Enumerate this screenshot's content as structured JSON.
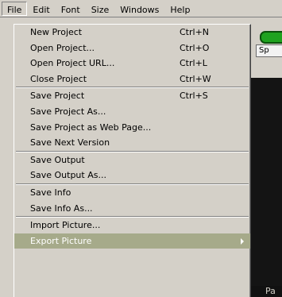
{
  "menubar": {
    "items": [
      {
        "label": "File"
      },
      {
        "label": "Edit"
      },
      {
        "label": "Font"
      },
      {
        "label": "Size"
      },
      {
        "label": "Windows"
      },
      {
        "label": "Help"
      }
    ]
  },
  "background": {
    "tab_label": "Sp",
    "bottom_text": "Pa",
    "pill_color": "#1fa21f"
  },
  "file_menu": {
    "items": [
      {
        "label": "New Project",
        "shortcut": "Ctrl+N"
      },
      {
        "label": "Open Project...",
        "shortcut": "Ctrl+O"
      },
      {
        "label": "Open Project URL...",
        "shortcut": "Ctrl+L"
      },
      {
        "label": "Close Project",
        "shortcut": "Ctrl+W"
      },
      {
        "label": "Save Project",
        "shortcut": "Ctrl+S"
      },
      {
        "label": "Save Project As..."
      },
      {
        "label": "Save Project as Web Page..."
      },
      {
        "label": "Save Next Version"
      },
      {
        "label": "Save Output"
      },
      {
        "label": "Save Output As..."
      },
      {
        "label": "Save Info"
      },
      {
        "label": "Save Info As..."
      },
      {
        "label": "Import Picture..."
      },
      {
        "label": "Export Picture"
      }
    ],
    "highlight_color": "#a6aa8a"
  }
}
